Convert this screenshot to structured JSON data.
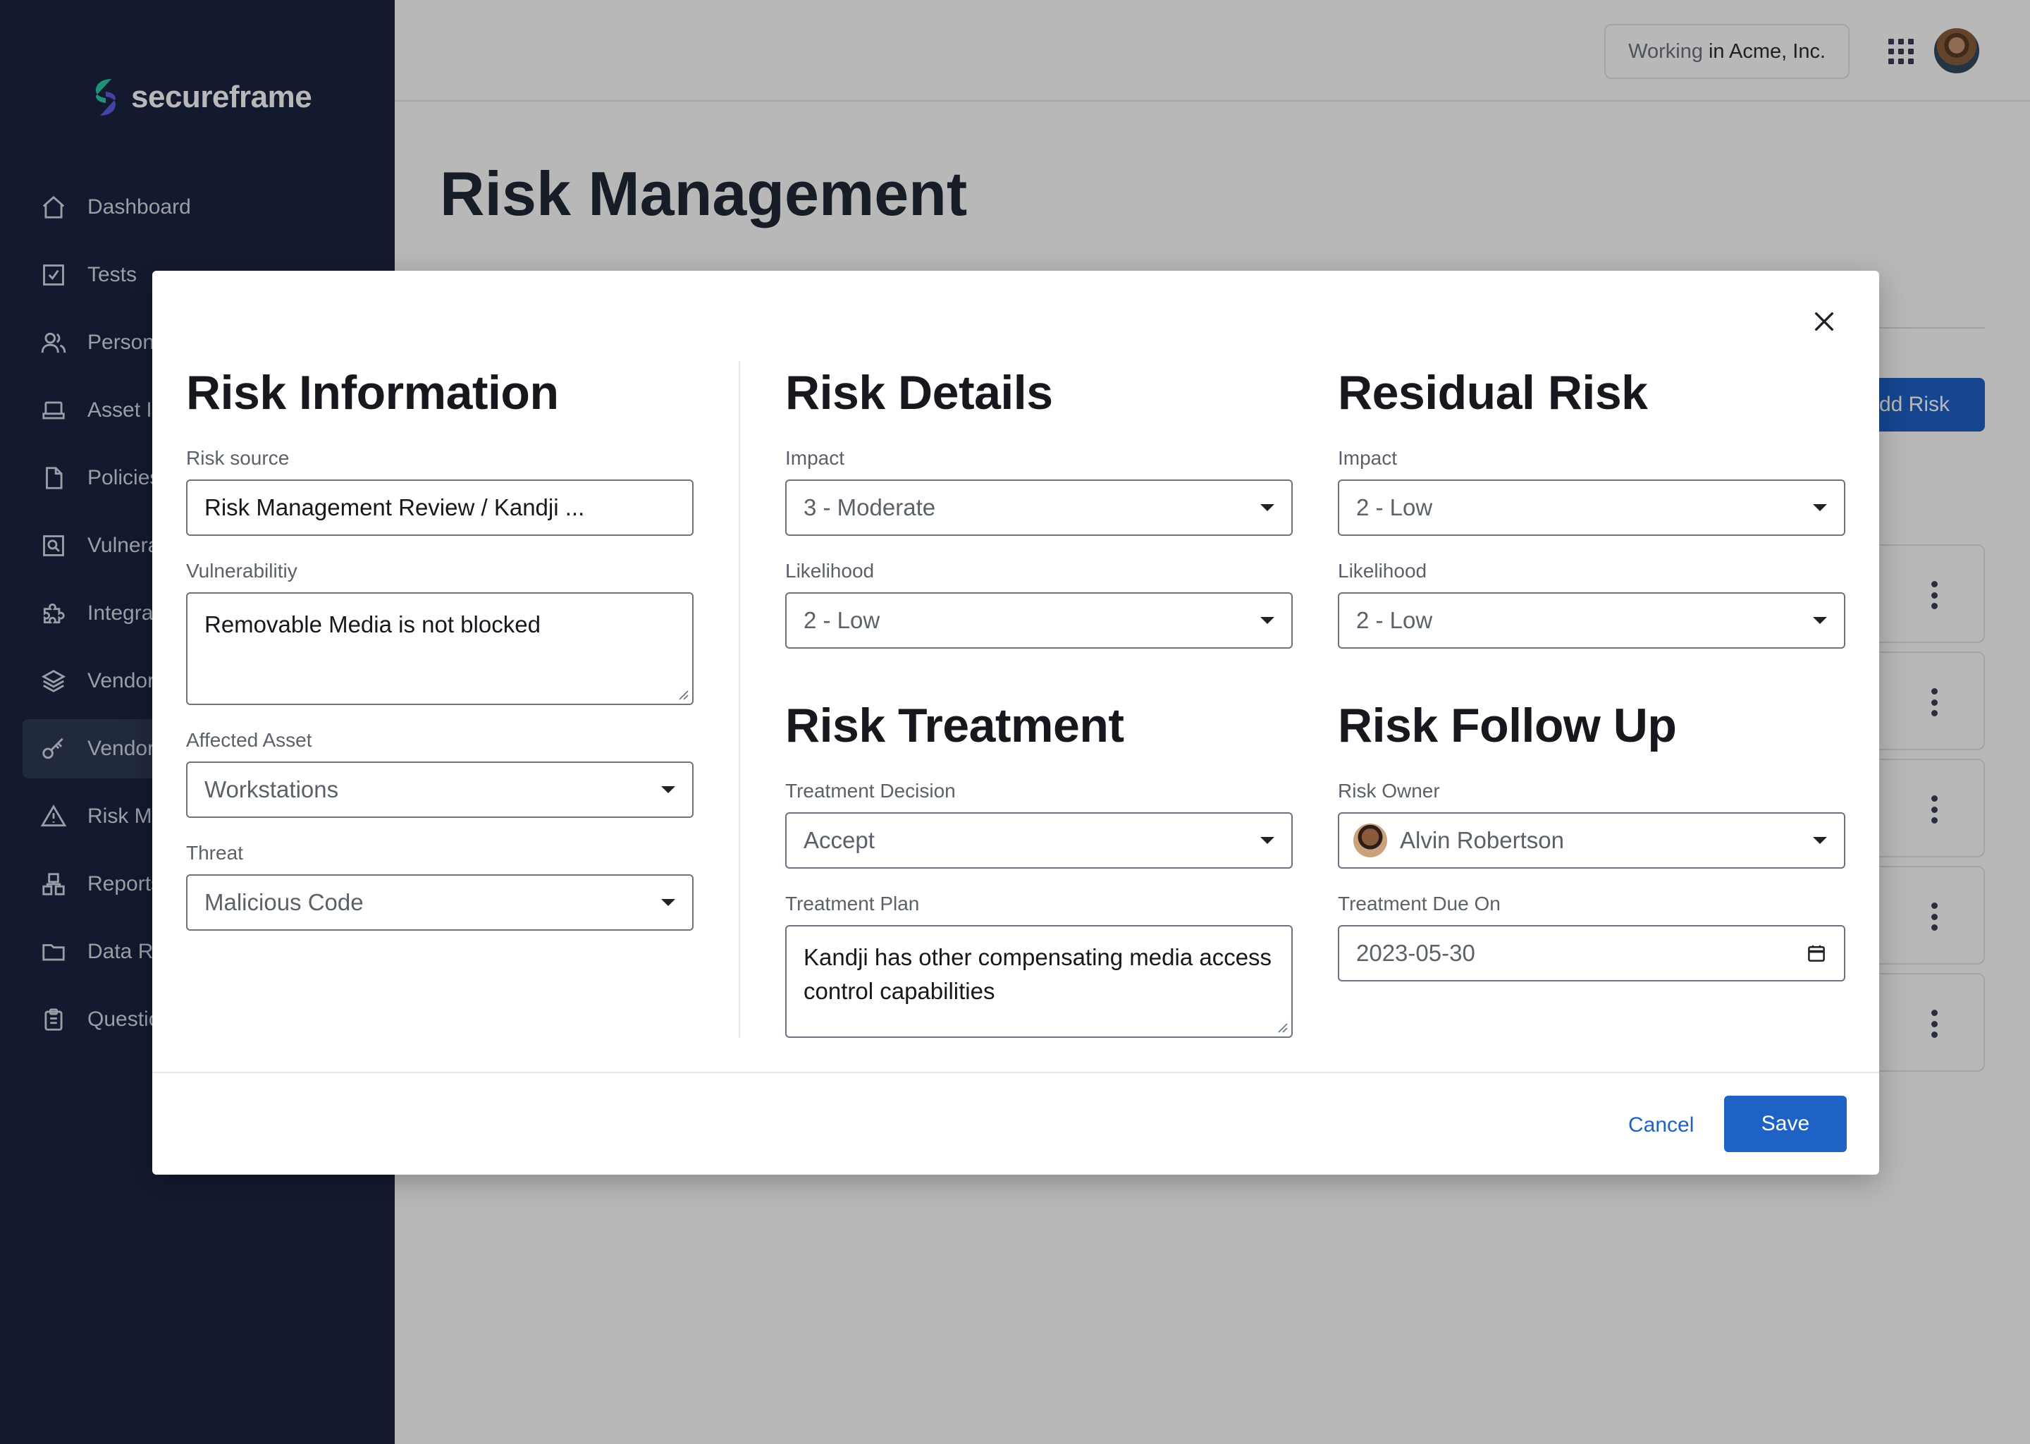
{
  "app": {
    "brand": "secureframe"
  },
  "sidebar": {
    "items": [
      {
        "label": "Dashboard",
        "icon": "home-icon"
      },
      {
        "label": "Tests",
        "icon": "checkbox-icon"
      },
      {
        "label": "Personnel",
        "icon": "people-icon"
      },
      {
        "label": "Asset Inventory",
        "icon": "laptop-icon"
      },
      {
        "label": "Policies",
        "icon": "document-icon"
      },
      {
        "label": "Vulnerabilities",
        "icon": "scan-icon"
      },
      {
        "label": "Integrations",
        "icon": "puzzle-icon"
      },
      {
        "label": "Vendors",
        "icon": "layers-icon"
      },
      {
        "label": "Vendor Access",
        "icon": "key-icon",
        "active": true
      },
      {
        "label": "Risk Management",
        "icon": "warning-icon"
      },
      {
        "label": "Reports",
        "icon": "reports-icon"
      },
      {
        "label": "Data Room",
        "icon": "folder-icon"
      },
      {
        "label": "Questionnaires",
        "icon": "clipboard-icon"
      }
    ]
  },
  "topbar": {
    "workspace_prefix": "Working",
    "workspace_name": "in Acme, Inc.",
    "apps_icon": "grid-icon",
    "avatar": "user-avatar"
  },
  "page": {
    "title": "Risk Management",
    "add_button": "Add Risk"
  },
  "modal": {
    "risk_information": {
      "title": "Risk Information",
      "risk_source_label": "Risk source",
      "risk_source_value": "Risk Management Review / Kandji ...",
      "vulnerability_label": "Vulnerabilitiy",
      "vulnerability_value": "Removable Media is not blocked",
      "affected_asset_label": "Affected Asset",
      "affected_asset_value": "Workstations",
      "threat_label": "Threat",
      "threat_value": "Malicious Code"
    },
    "risk_details": {
      "title": "Risk Details",
      "impact_label": "Impact",
      "impact_value": "3 - Moderate",
      "likelihood_label": "Likelihood",
      "likelihood_value": "2 - Low"
    },
    "residual_risk": {
      "title": "Residual Risk",
      "impact_label": "Impact",
      "impact_value": "2 - Low",
      "likelihood_label": "Likelihood",
      "likelihood_value": "2 - Low"
    },
    "risk_treatment": {
      "title": "Risk Treatment",
      "decision_label": "Treatment Decision",
      "decision_value": "Accept",
      "plan_label": "Treatment Plan",
      "plan_value": "Kandji has other compensating media access control capabilities"
    },
    "risk_follow_up": {
      "title": "Risk Follow Up",
      "owner_label": "Risk Owner",
      "owner_value": "Alvin Robertson",
      "due_label": "Treatment Due On",
      "due_value": "2023-05-30"
    },
    "cancel_label": "Cancel",
    "save_label": "Save"
  }
}
